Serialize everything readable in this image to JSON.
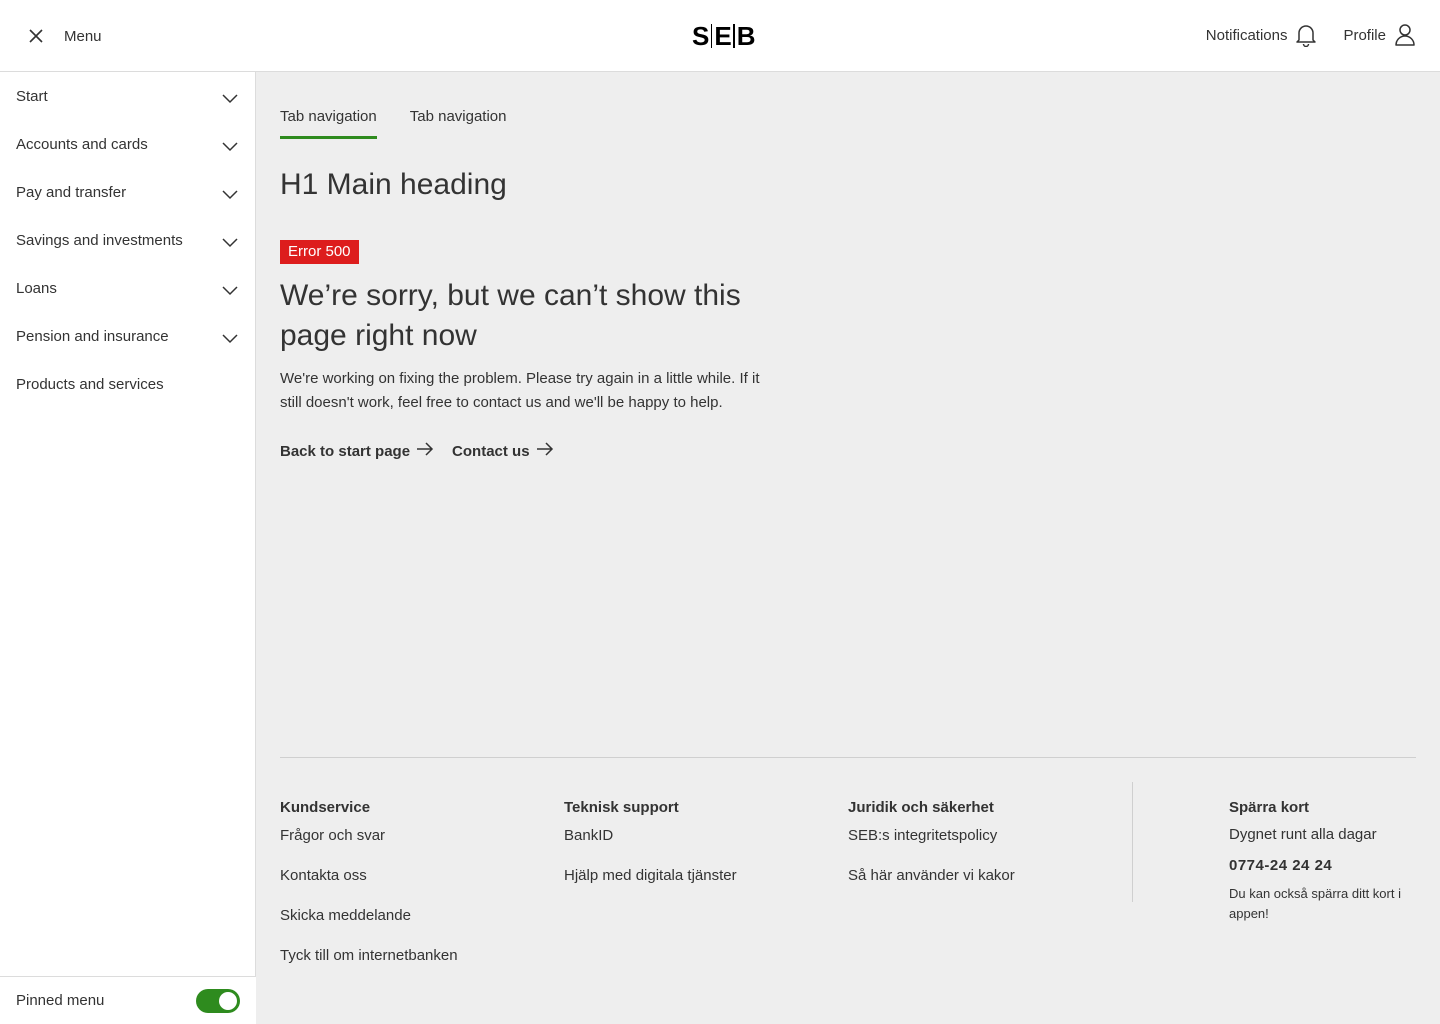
{
  "header": {
    "menu_label": "Menu",
    "logo_left": "S",
    "logo_mid": "E",
    "logo_right": "B",
    "notifications_label": "Notifications",
    "profile_label": "Profile"
  },
  "sidebar": {
    "items": [
      {
        "label": "Start",
        "has_chevron": true
      },
      {
        "label": "Accounts and cards",
        "has_chevron": true
      },
      {
        "label": "Pay and transfer",
        "has_chevron": true
      },
      {
        "label": "Savings and investments",
        "has_chevron": true
      },
      {
        "label": "Loans",
        "has_chevron": true
      },
      {
        "label": "Pension and insurance",
        "has_chevron": true
      },
      {
        "label": "Products and services",
        "has_chevron": false
      }
    ],
    "pinned_label": "Pinned menu",
    "pinned_on": true
  },
  "main": {
    "tabs": [
      {
        "label": "Tab navigation",
        "active": true
      },
      {
        "label": "Tab navigation",
        "active": false
      }
    ],
    "heading": "H1 Main heading",
    "badge": "Error 500",
    "sorry_title": "We’re sorry, but we can’t show this page right now",
    "paragraph": "We're working on fixing the problem. Please try again in a little while. If it still doesn't work, feel free to contact us and we'll be happy to help.",
    "links": [
      {
        "label": "Back to start page"
      },
      {
        "label": "Contact us"
      }
    ]
  },
  "footer": {
    "columns": [
      {
        "title": "Kundservice",
        "links": [
          "Frågor och svar",
          "Kontakta oss",
          "Skicka meddelande",
          "Tyck till om internetbanken"
        ]
      },
      {
        "title": "Teknisk support",
        "links": [
          "BankID",
          "Hjälp med digitala tjänster"
        ]
      },
      {
        "title": "Juridik och säkerhet",
        "links": [
          "SEB:s integritetspolicy",
          "Så här använder vi kakor"
        ]
      }
    ],
    "block_card": {
      "title": "Spärra kort",
      "subtitle": "Dygnet runt alla dagar",
      "phone": "0774-24 24 24",
      "note": "Du kan också spärra ditt kort i appen!"
    }
  },
  "colors": {
    "accent_green": "#2e8b1e",
    "error_red": "#dd1d1d",
    "background": "#eeeeee"
  }
}
